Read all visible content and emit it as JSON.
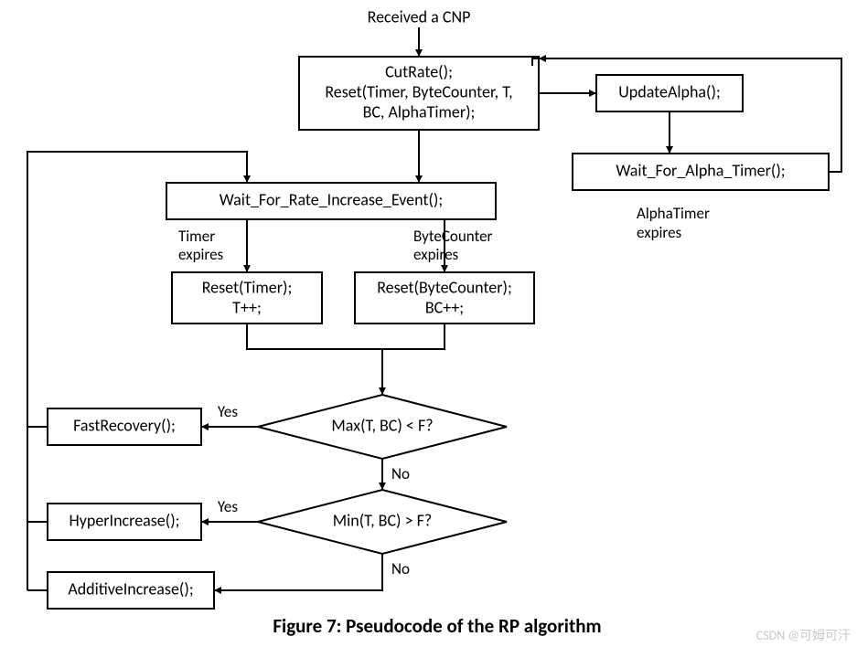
{
  "start_label": "Received a CNP",
  "nodes": {
    "cutrate_l1": "CutRate();",
    "cutrate_l2": "Reset(Timer, ByteCounter, T,",
    "cutrate_l3": "BC, AlphaTimer);",
    "updatealpha": "UpdateAlpha();",
    "waitalpha": "Wait_For_Alpha_Timer();",
    "waitrate": "Wait_For_Rate_Increase_Event();",
    "resettimer_l1": "Reset(Timer);",
    "resettimer_l2": "T++;",
    "resetbc_l1": "Reset(ByteCounter);",
    "resetbc_l2": "BC++;",
    "decision1": "Max(T, BC) < F?",
    "decision2": "Min(T, BC) > F?",
    "fastrecovery": "FastRecovery();",
    "hyperincrease": "HyperIncrease();",
    "additiveincrease": "AdditiveIncrease();"
  },
  "edges": {
    "timer_l1": "Timer",
    "timer_l2": "expires",
    "bc_l1": "ByteCounter",
    "bc_l2": "expires",
    "alpha_l1": "AlphaTimer",
    "alpha_l2": "expires",
    "yes": "Yes",
    "no": "No"
  },
  "caption": "Figure 7: Pseudocode of the RP algorithm",
  "watermark": "CSDN @可姆可汗"
}
